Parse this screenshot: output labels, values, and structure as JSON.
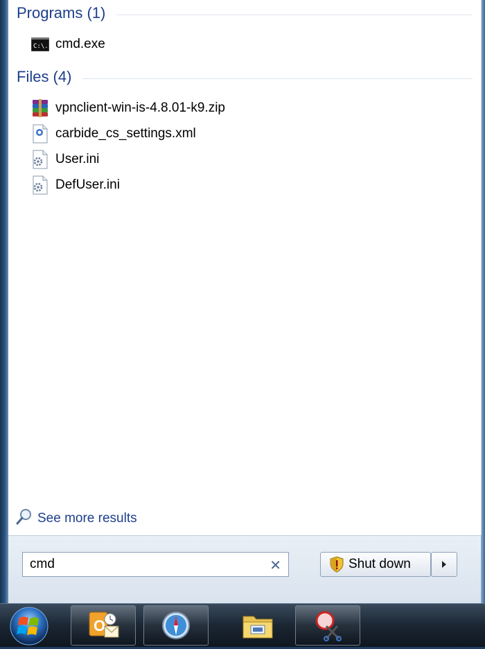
{
  "programs": {
    "header": "Programs (1)",
    "items": [
      {
        "label": "cmd.exe",
        "icon": "cmd-icon"
      }
    ]
  },
  "files": {
    "header": "Files (4)",
    "items": [
      {
        "label": "vpnclient-win-is-4.8.01-k9.zip",
        "icon": "winrar-archive-icon"
      },
      {
        "label": "carbide_cs_settings.xml",
        "icon": "xml-file-icon"
      },
      {
        "label": "User.ini",
        "icon": "ini-file-icon"
      },
      {
        "label": "DefUser.ini",
        "icon": "ini-file-icon"
      }
    ]
  },
  "see_more": {
    "label": "See more results",
    "icon": "search-icon"
  },
  "search": {
    "value": "cmd",
    "clear_icon": "clear-icon"
  },
  "shutdown": {
    "label": "Shut down",
    "icon": "uac-shield-icon",
    "arrow_icon": "chevron-right-icon"
  },
  "taskbar": {
    "start_icon": "windows-start-orb-icon",
    "apps": [
      {
        "icon": "outlook-icon"
      },
      {
        "icon": "safari-icon"
      },
      {
        "icon": "file-explorer-icon"
      },
      {
        "icon": "snipping-tool-icon"
      }
    ]
  },
  "colors": {
    "header_blue": "#1e3f8c",
    "accent_blue": "#1e3f8c",
    "panel_bg": "#ffffff"
  }
}
